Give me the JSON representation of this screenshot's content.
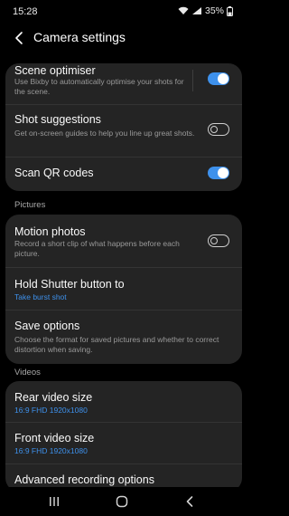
{
  "status_bar": {
    "time": "15:28",
    "battery": "35%"
  },
  "header": {
    "title": "Camera settings"
  },
  "settings_top": [
    {
      "title": "Scene optimiser",
      "description": "Use Bixby to automatically optimise your shots for the scene.",
      "toggle": true
    },
    {
      "title": "Shot suggestions",
      "description": "Get on-screen guides to help you line up great shots.",
      "toggle": false
    },
    {
      "title": "Scan QR codes",
      "toggle": true
    }
  ],
  "pictures_section": {
    "label": "Pictures",
    "items": [
      {
        "title": "Motion photos",
        "description": "Record a short clip of what happens before each picture.",
        "toggle": false
      },
      {
        "title": "Hold Shutter button to",
        "value": "Take burst shot"
      },
      {
        "title": "Save options",
        "description": "Choose the format for saved pictures and whether to correct distortion when saving."
      }
    ]
  },
  "videos_section": {
    "label": "Videos",
    "items": [
      {
        "title": "Rear video size",
        "value": "16:9 FHD 1920x1080"
      },
      {
        "title": "Front video size",
        "value": "16:9 FHD 1920x1080"
      },
      {
        "title": "Advanced recording options"
      }
    ]
  },
  "colors": {
    "accent": "#3e91ec",
    "card": "#242424",
    "background": "#000000"
  },
  "nav_icons": [
    "recents-icon",
    "home-icon",
    "back-icon"
  ]
}
